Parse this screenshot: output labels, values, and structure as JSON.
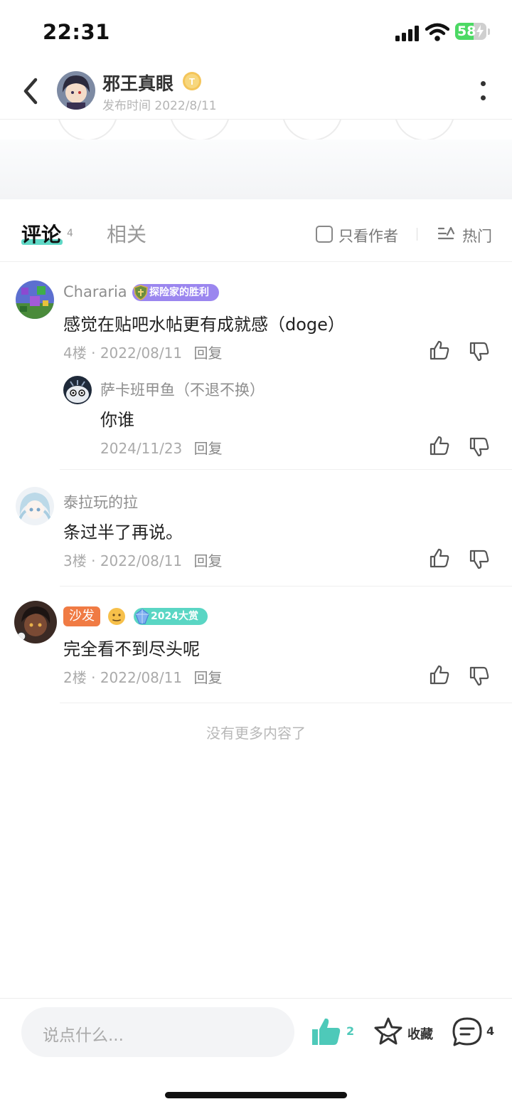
{
  "status_bar": {
    "time": "22:31",
    "battery": "58",
    "battery_level": 0.58
  },
  "header": {
    "author_name": "邪王真眼",
    "post_time": "发布时间 2022/8/11",
    "badge_letter": "T"
  },
  "tabs": {
    "comments_label": "评论",
    "comments_count": "4",
    "related_label": "相关",
    "only_author_label": "只看作者",
    "sort_label": "热门"
  },
  "comments": [
    {
      "username": "Chararia",
      "title_badge": "探险家的胜利",
      "content": "感觉在贴吧水帖更有成就感（doge）",
      "floor": "4楼",
      "date": "2022/08/11",
      "reply_label": "回复",
      "replies": [
        {
          "username": "萨卡班甲鱼（不退不换）",
          "content": "你谁",
          "date": "2024/11/23",
          "reply_label": "回复"
        }
      ]
    },
    {
      "username": "泰拉玩的拉",
      "content": "条过半了再说。",
      "floor": "3楼",
      "date": "2022/08/11",
      "reply_label": "回复"
    },
    {
      "username": "",
      "sofa_badge": "沙发",
      "title_badge": "2024大赏",
      "content": "完全看不到尽头呢",
      "floor": "2楼",
      "date": "2022/08/11",
      "reply_label": "回复"
    }
  ],
  "meta_separator": "·",
  "end_text": "没有更多内容了",
  "bottom_bar": {
    "input_placeholder": "说点什么...",
    "like_count": "2",
    "favorite_label": "收藏",
    "comment_count": "4"
  },
  "colors": {
    "accent": "#4ec9b9",
    "tab_underline": "#5fd8c6",
    "sofa_badge": "#f07b44",
    "explorer_badge": "#9b86ef",
    "award_badge": "#5ad6c4"
  },
  "icons": [
    "back-icon",
    "more-icon",
    "thumb-up-icon",
    "thumb-down-icon",
    "star-icon",
    "chat-bubble-icon",
    "sort-icon",
    "wifi-icon"
  ]
}
